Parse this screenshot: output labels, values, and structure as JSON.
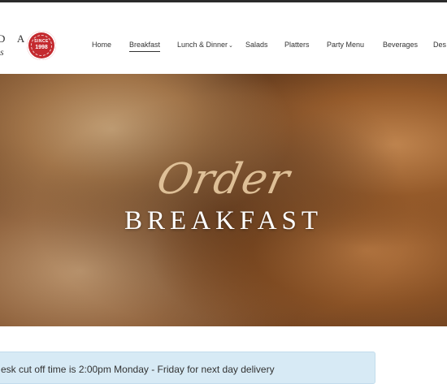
{
  "brand": {
    "letters": "D A",
    "script": "s",
    "seal_top": "SINCE",
    "seal_year": "1998"
  },
  "nav": {
    "items": [
      {
        "label": "Home"
      },
      {
        "label": "Breakfast"
      },
      {
        "label": "Lunch & Dinner"
      },
      {
        "label": "Salads"
      },
      {
        "label": "Platters"
      },
      {
        "label": "Party Menu"
      },
      {
        "label": "Beverages"
      },
      {
        "label": "Des"
      }
    ],
    "active": "Breakfast"
  },
  "hero": {
    "script": "Order",
    "title": "BREAKFAST"
  },
  "notice": {
    "text": "esk cut off time is 2:00pm Monday - Friday for next day delivery"
  },
  "colors": {
    "seal": "#c42a2f",
    "notice_bg": "#d7eaf5",
    "script_text": "#e7c9a0"
  }
}
